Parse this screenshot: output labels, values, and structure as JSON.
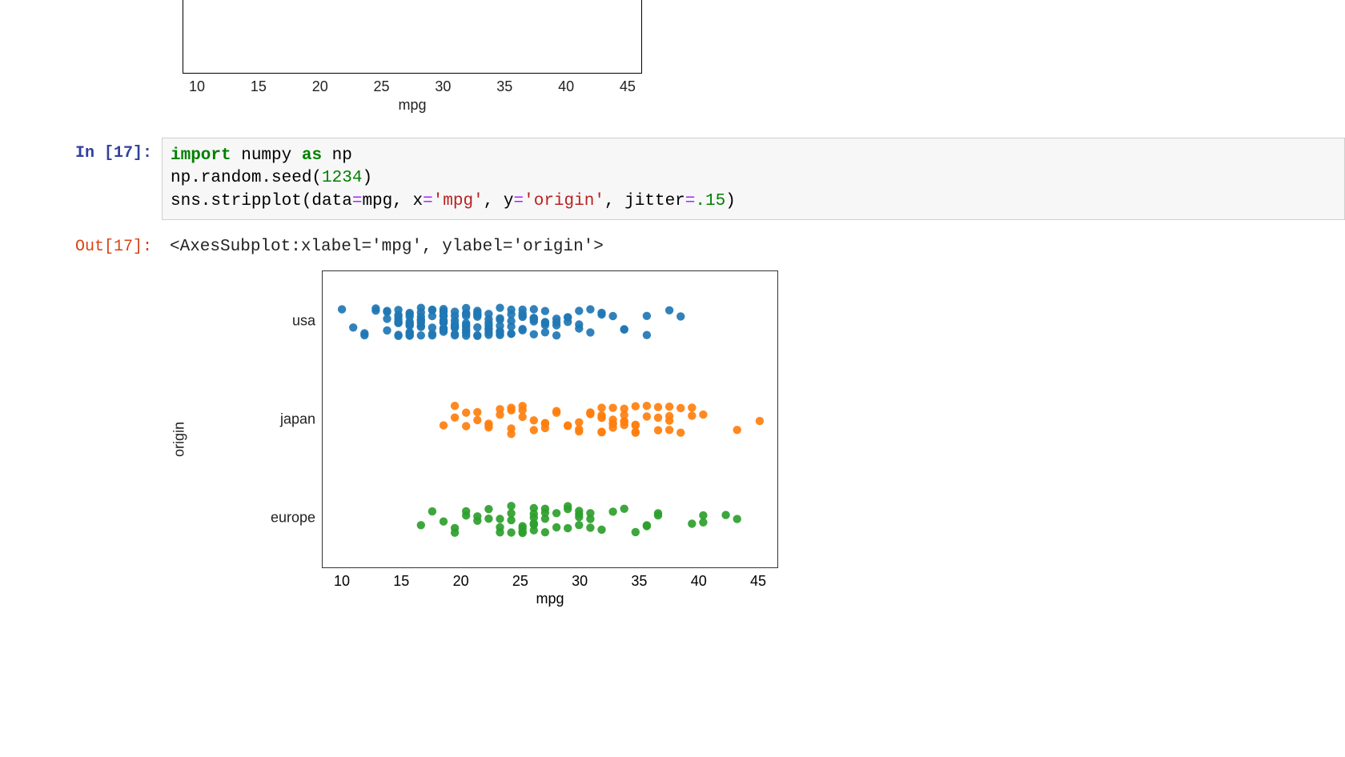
{
  "residual_chart": {
    "xlabel": "mpg",
    "xticks": [
      "10",
      "15",
      "20",
      "25",
      "30",
      "35",
      "40",
      "45"
    ]
  },
  "cell": {
    "exec_count": 17,
    "in_prompt": "In [17]:",
    "out_prompt": "Out[17]:",
    "code": {
      "kw_import": "import",
      "mod_numpy": " numpy ",
      "kw_as": "as",
      "alias_np": " np",
      "line2_pre": "np.random.seed(",
      "seed_val": "1234",
      "line2_post": ")",
      "line3_pre": "sns.stripplot(data",
      "eq": "=",
      "mpg_id": "mpg, x",
      "eq2": "=",
      "str_mpg": "'mpg'",
      "comma_y": ", y",
      "eq3": "=",
      "str_origin": "'origin'",
      "comma_j": ", jitter",
      "eq4": "=",
      "jitter_val": ".15",
      "close_paren": ")"
    },
    "output_repr": "<AxesSubplot:xlabel='mpg', ylabel='origin'>"
  },
  "chart_data": {
    "type": "strip-scatter-categorical",
    "xlabel": "mpg",
    "ylabel": "origin",
    "xlim": [
      8,
      47
    ],
    "xticks": [
      "10",
      "15",
      "20",
      "25",
      "30",
      "35",
      "40",
      "45"
    ],
    "categories": [
      "usa",
      "japan",
      "europe"
    ],
    "jitter": 0.15,
    "colors": {
      "usa": "#1f77b4",
      "japan": "#ff7f0e",
      "europe": "#2ca02c"
    },
    "series": [
      {
        "name": "usa",
        "x": [
          9,
          10,
          11,
          11,
          12,
          12,
          13,
          13,
          13,
          13,
          14,
          14,
          14,
          14,
          14,
          14,
          14,
          14,
          14,
          15,
          15,
          15,
          15,
          15,
          15,
          15,
          15,
          15,
          15,
          15,
          15,
          16,
          16,
          16,
          16,
          16,
          16,
          16,
          16,
          16,
          17,
          17,
          17,
          17,
          17,
          17,
          18,
          18,
          18,
          18,
          18,
          18,
          18,
          18,
          18,
          18,
          18,
          18,
          18,
          18,
          19,
          19,
          19,
          19,
          19,
          19,
          19,
          19,
          19,
          20,
          20,
          20,
          20,
          20,
          20,
          20,
          20,
          20,
          20,
          20,
          21,
          21,
          21,
          21,
          21,
          21,
          21,
          21,
          22,
          22,
          22,
          22,
          22,
          22,
          22,
          22,
          23,
          23,
          23,
          23,
          23,
          23,
          23,
          23,
          24,
          24,
          24,
          24,
          24,
          24,
          25,
          25,
          25,
          25,
          25,
          25,
          26,
          26,
          26,
          26,
          26,
          26,
          27,
          27,
          27,
          27,
          27,
          28,
          28,
          28,
          28,
          29,
          29,
          29,
          30,
          30,
          30,
          31,
          31,
          32,
          32,
          33,
          34,
          34,
          36,
          36,
          38,
          39
        ],
        "y_level": 0
      },
      {
        "name": "japan",
        "x": [
          18,
          19,
          19,
          20,
          20,
          21,
          21,
          22,
          22,
          22,
          23,
          23,
          24,
          24,
          24,
          24,
          25,
          25,
          25,
          26,
          26,
          27,
          27,
          27,
          27,
          28,
          28,
          29,
          29,
          30,
          30,
          30,
          31,
          31,
          31,
          31,
          32,
          32,
          32,
          32,
          32,
          32,
          33,
          33,
          33,
          33,
          33,
          34,
          34,
          34,
          34,
          34,
          35,
          35,
          35,
          35,
          35,
          36,
          36,
          37,
          37,
          37,
          38,
          38,
          38,
          38,
          39,
          39,
          40,
          40,
          41,
          44,
          46
        ],
        "y_level": 1
      },
      {
        "name": "europe",
        "x": [
          16,
          17,
          18,
          19,
          19,
          20,
          20,
          21,
          21,
          22,
          22,
          23,
          23,
          23,
          24,
          24,
          24,
          24,
          25,
          25,
          25,
          25,
          26,
          26,
          26,
          26,
          26,
          26,
          27,
          27,
          27,
          27,
          28,
          28,
          29,
          29,
          29,
          30,
          30,
          30,
          30,
          31,
          31,
          31,
          32,
          33,
          34,
          35,
          36,
          36,
          37,
          37,
          40,
          41,
          41,
          43,
          44
        ],
        "y_level": 2
      }
    ]
  }
}
